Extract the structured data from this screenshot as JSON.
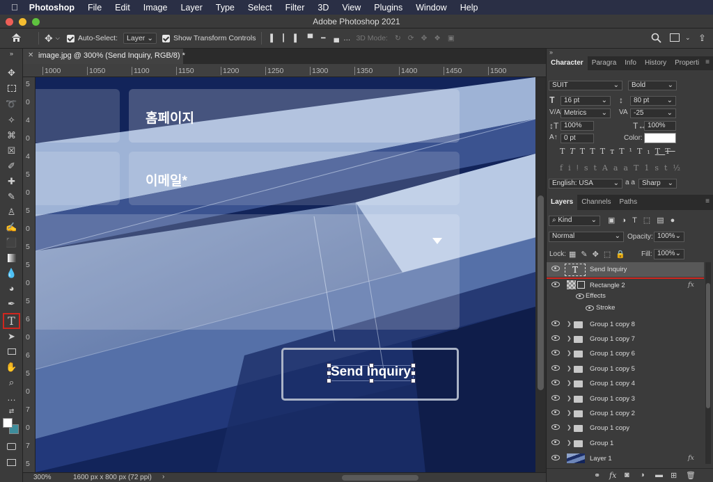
{
  "menubar": {
    "app": "Photoshop",
    "items": [
      "File",
      "Edit",
      "Image",
      "Layer",
      "Type",
      "Select",
      "Filter",
      "3D",
      "View",
      "Plugins",
      "Window",
      "Help"
    ]
  },
  "window": {
    "title": "Adobe Photoshop 2021"
  },
  "options": {
    "auto_select": "Auto-Select:",
    "layer_dropdown": "Layer",
    "show_transform": "Show Transform Controls",
    "mode3d": "3D Mode:"
  },
  "document": {
    "tab": "image.jpg @ 300% (Send Inquiry, RGB/8) *",
    "zoom": "300%",
    "info": "1600 px x 800 px (72 ppi)"
  },
  "ruler": {
    "h": [
      "1000",
      "1050",
      "1100",
      "1150",
      "1200",
      "1250",
      "1300",
      "1350",
      "1400",
      "1450",
      "1500"
    ],
    "v": [
      "5",
      "0",
      "4",
      "0",
      "4",
      "5",
      "0",
      "5",
      "0",
      "5",
      "5",
      "0",
      "5",
      "6",
      "0",
      "6",
      "5",
      "0",
      "7",
      "0",
      "7",
      "5"
    ]
  },
  "canvas": {
    "field1": "홈페이지",
    "field2": "이메일*",
    "button": "Send Inquiry"
  },
  "character": {
    "tabs": [
      "Character",
      "Paragra",
      "Info",
      "History",
      "Properti"
    ],
    "font": "SUIT",
    "style": "Bold",
    "size": "16 pt",
    "leading": "80 pt",
    "kerning": "Metrics",
    "tracking": "-25",
    "vscale": "100%",
    "hscale": "100%",
    "baseline": "0 pt",
    "color_label": "Color:",
    "language": "English: USA",
    "antialias": "Sharp",
    "aa": "a a"
  },
  "layers": {
    "tabs": [
      "Layers",
      "Channels",
      "Paths"
    ],
    "kind": "Kind",
    "blend": "Normal",
    "opacity_label": "Opacity:",
    "opacity": "100%",
    "lock_label": "Lock:",
    "fill_label": "Fill:",
    "fill": "100%",
    "items": [
      {
        "name": "Send Inquiry",
        "type": "text",
        "selected": true
      },
      {
        "name": "Rectangle 2",
        "type": "shape",
        "fx": true
      },
      {
        "name": "Effects",
        "type": "effects"
      },
      {
        "name": "Stroke",
        "type": "effect"
      },
      {
        "name": "Group 1 copy 8",
        "type": "group"
      },
      {
        "name": "Group 1 copy 7",
        "type": "group"
      },
      {
        "name": "Group 1 copy 6",
        "type": "group"
      },
      {
        "name": "Group 1 copy 5",
        "type": "group"
      },
      {
        "name": "Group 1 copy 4",
        "type": "group"
      },
      {
        "name": "Group 1 copy 3",
        "type": "group"
      },
      {
        "name": "Group 1 copy 2",
        "type": "group"
      },
      {
        "name": "Group 1 copy",
        "type": "group"
      },
      {
        "name": "Group 1",
        "type": "group"
      },
      {
        "name": "Layer 1",
        "type": "image",
        "fx": true
      }
    ],
    "fx_label": "fx"
  }
}
